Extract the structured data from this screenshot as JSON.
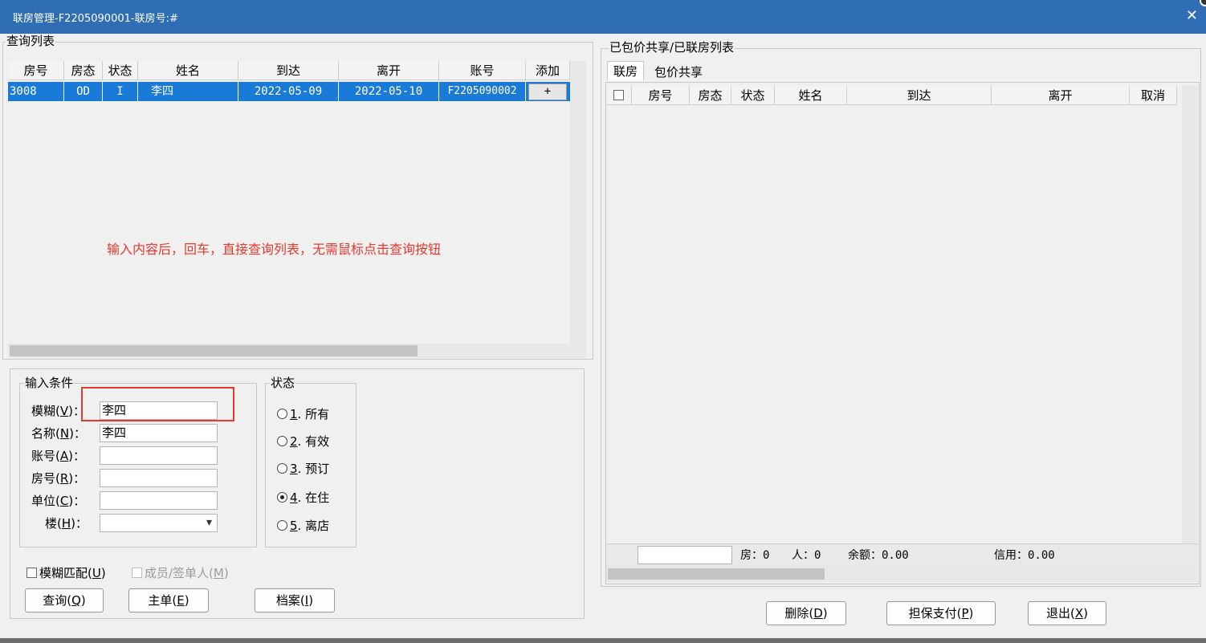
{
  "window": {
    "title": "联房管理-F2205090001-联房号:#",
    "close_glyph": "✕"
  },
  "query_list": {
    "group_title": "查询列表",
    "columns": [
      "房号",
      "房态",
      "状态",
      "姓名",
      "到达",
      "离开",
      "账号",
      "添加"
    ],
    "rows": [
      {
        "room": "3008",
        "room_status": "OD",
        "status": "I",
        "name": "李四",
        "arrival": "2022-05-09",
        "departure": "2022-05-10",
        "account": "F2205090002",
        "add": "+"
      }
    ],
    "hint": "输入内容后，回车，直接查询列表，无需鼠标点击查询按钮"
  },
  "input_conditions": {
    "group_title": "输入条件",
    "fields": [
      {
        "label": "模糊(",
        "key": "V",
        "suffix": ")：",
        "value": "李四"
      },
      {
        "label": "名称(",
        "key": "N",
        "suffix": ")：",
        "value": "李四"
      },
      {
        "label": "账号(",
        "key": "A",
        "suffix": ")：",
        "value": ""
      },
      {
        "label": "房号(",
        "key": "R",
        "suffix": ")：",
        "value": ""
      },
      {
        "label": "单位(",
        "key": "C",
        "suffix": ")：",
        "value": ""
      },
      {
        "label": "楼(",
        "key": "H",
        "suffix": ")：",
        "value": ""
      }
    ],
    "dropdown_glyph": "▾"
  },
  "status_group": {
    "group_title": "状态",
    "options": [
      {
        "num": "1",
        "text": ". 所有",
        "selected": false
      },
      {
        "num": "2",
        "text": ". 有效",
        "selected": false
      },
      {
        "num": "3",
        "text": ". 预订",
        "selected": false
      },
      {
        "num": "4",
        "text": ". 在住",
        "selected": true
      },
      {
        "num": "5",
        "text": ". 离店",
        "selected": false
      }
    ]
  },
  "checkboxes": {
    "fuzzy": {
      "label": "模糊匹配(",
      "key": "U",
      "suffix": ")",
      "checked": false,
      "enabled": true
    },
    "members": {
      "label": "成员/签单人(",
      "key": "M",
      "suffix": ")",
      "checked": false,
      "enabled": false
    }
  },
  "left_buttons": [
    {
      "label": "查询(",
      "key": "Q",
      "suffix": ")"
    },
    {
      "label": "主单(",
      "key": "E",
      "suffix": ")"
    },
    {
      "label": "档案(",
      "key": "I",
      "suffix": ")"
    }
  ],
  "right_panel": {
    "group_title": "已包价共享/已联房列表",
    "tabs": [
      "联房",
      "包价共享"
    ],
    "columns": [
      "房号",
      "房态",
      "状态",
      "姓名",
      "到达",
      "离开",
      "取消"
    ],
    "summary": {
      "rooms_label": "房：",
      "rooms": "0",
      "people_label": "人：",
      "people": "0",
      "balance_label": "余额：",
      "balance": "0.00",
      "credit_label": "信用：",
      "credit": "0.00"
    }
  },
  "right_buttons": [
    {
      "label": "删除(",
      "key": "D",
      "suffix": ")"
    },
    {
      "label": "担保支付(",
      "key": "P",
      "suffix": ")"
    },
    {
      "label": "退出(",
      "key": "X",
      "suffix": ")"
    }
  ],
  "colors": {
    "title_bar": "#2f6db5",
    "selected_row": "#1a7ad8",
    "hint_text": "#e53a2e",
    "highlight_box": "#e53a2e"
  }
}
